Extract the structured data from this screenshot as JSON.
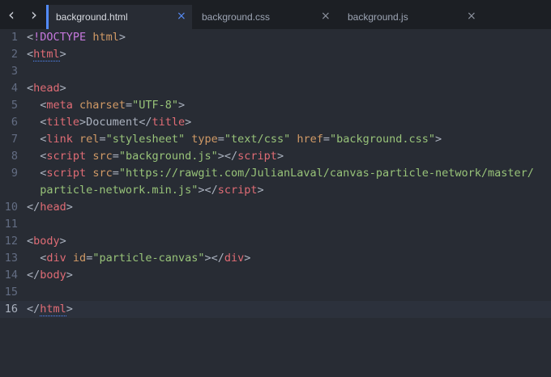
{
  "tabs": [
    {
      "label": "background.html",
      "active": true
    },
    {
      "label": "background.css",
      "active": false
    },
    {
      "label": "background.js",
      "active": false
    }
  ],
  "icons": {
    "back": "chevron-left-icon",
    "forward": "chevron-right-icon",
    "close": "close-icon"
  },
  "colors": {
    "accent": "#528bff",
    "tag": "#e06c75",
    "attribute": "#d19a66",
    "string": "#98c379",
    "doctype": "#c678dd",
    "text": "#abb2bf"
  },
  "editor": {
    "current_line": 16,
    "lines": [
      {
        "num": "1",
        "tokens": [
          {
            "t": "punct",
            "v": "<"
          },
          {
            "t": "doctype",
            "v": "!DOCTYPE"
          },
          {
            "t": "punct",
            "v": " "
          },
          {
            "t": "attr",
            "v": "html"
          },
          {
            "t": "punct",
            "v": ">"
          }
        ]
      },
      {
        "num": "2",
        "tokens": [
          {
            "t": "punct",
            "v": "<"
          },
          {
            "t": "tag",
            "v": "html"
          },
          {
            "t": "punct",
            "v": ">"
          }
        ]
      },
      {
        "num": "3",
        "tokens": []
      },
      {
        "num": "4",
        "tokens": [
          {
            "t": "punct",
            "v": "<"
          },
          {
            "t": "tag",
            "v": "head"
          },
          {
            "t": "punct",
            "v": ">"
          }
        ]
      },
      {
        "num": "5",
        "tokens": [
          {
            "t": "punct",
            "v": "  <"
          },
          {
            "t": "tag",
            "v": "meta"
          },
          {
            "t": "punct",
            "v": " "
          },
          {
            "t": "attr",
            "v": "charset"
          },
          {
            "t": "punct",
            "v": "="
          },
          {
            "t": "str",
            "v": "\"UTF-8\""
          },
          {
            "t": "punct",
            "v": ">"
          }
        ]
      },
      {
        "num": "6",
        "tokens": [
          {
            "t": "punct",
            "v": "  <"
          },
          {
            "t": "tag",
            "v": "title"
          },
          {
            "t": "punct",
            "v": ">"
          },
          {
            "t": "txt",
            "v": "Document"
          },
          {
            "t": "punct",
            "v": "</"
          },
          {
            "t": "tag",
            "v": "title"
          },
          {
            "t": "punct",
            "v": ">"
          }
        ]
      },
      {
        "num": "7",
        "tokens": [
          {
            "t": "punct",
            "v": "  <"
          },
          {
            "t": "tag",
            "v": "link"
          },
          {
            "t": "punct",
            "v": " "
          },
          {
            "t": "attr",
            "v": "rel"
          },
          {
            "t": "punct",
            "v": "="
          },
          {
            "t": "str",
            "v": "\"stylesheet\""
          },
          {
            "t": "punct",
            "v": " "
          },
          {
            "t": "attr",
            "v": "type"
          },
          {
            "t": "punct",
            "v": "="
          },
          {
            "t": "str",
            "v": "\"text/css\""
          },
          {
            "t": "punct",
            "v": " "
          },
          {
            "t": "attr",
            "v": "href"
          },
          {
            "t": "punct",
            "v": "="
          },
          {
            "t": "str",
            "v": "\"background.css\""
          },
          {
            "t": "punct",
            "v": ">"
          }
        ]
      },
      {
        "num": "8",
        "tokens": [
          {
            "t": "punct",
            "v": "  <"
          },
          {
            "t": "tag",
            "v": "script"
          },
          {
            "t": "punct",
            "v": " "
          },
          {
            "t": "attr",
            "v": "src"
          },
          {
            "t": "punct",
            "v": "="
          },
          {
            "t": "str",
            "v": "\"background.js\""
          },
          {
            "t": "punct",
            "v": "></"
          },
          {
            "t": "tag",
            "v": "script"
          },
          {
            "t": "punct",
            "v": ">"
          }
        ]
      },
      {
        "num": "9",
        "tokens": [
          {
            "t": "punct",
            "v": "  <"
          },
          {
            "t": "tag",
            "v": "script"
          },
          {
            "t": "punct",
            "v": " "
          },
          {
            "t": "attr",
            "v": "src"
          },
          {
            "t": "punct",
            "v": "="
          },
          {
            "t": "str",
            "v": "\"https://rawgit.com/JulianLaval/canvas-particle-network/master/"
          }
        ]
      },
      {
        "num": "",
        "tokens": [
          {
            "t": "str",
            "v": "  particle-network.min.js\""
          },
          {
            "t": "punct",
            "v": "></"
          },
          {
            "t": "tag",
            "v": "script"
          },
          {
            "t": "punct",
            "v": ">"
          }
        ]
      },
      {
        "num": "10",
        "tokens": [
          {
            "t": "punct",
            "v": "</"
          },
          {
            "t": "tag",
            "v": "head"
          },
          {
            "t": "punct",
            "v": ">"
          }
        ]
      },
      {
        "num": "11",
        "tokens": []
      },
      {
        "num": "12",
        "tokens": [
          {
            "t": "punct",
            "v": "<"
          },
          {
            "t": "tag",
            "v": "body"
          },
          {
            "t": "punct",
            "v": ">"
          }
        ]
      },
      {
        "num": "13",
        "tokens": [
          {
            "t": "punct",
            "v": "  <"
          },
          {
            "t": "tag",
            "v": "div"
          },
          {
            "t": "punct",
            "v": " "
          },
          {
            "t": "attr",
            "v": "id"
          },
          {
            "t": "punct",
            "v": "="
          },
          {
            "t": "str",
            "v": "\"particle-canvas\""
          },
          {
            "t": "punct",
            "v": "></"
          },
          {
            "t": "tag",
            "v": "div"
          },
          {
            "t": "punct",
            "v": ">"
          }
        ]
      },
      {
        "num": "14",
        "tokens": [
          {
            "t": "punct",
            "v": "</"
          },
          {
            "t": "tag",
            "v": "body"
          },
          {
            "t": "punct",
            "v": ">"
          }
        ]
      },
      {
        "num": "15",
        "tokens": []
      },
      {
        "num": "16",
        "tokens": [
          {
            "t": "punct",
            "v": "</"
          },
          {
            "t": "tag",
            "v": "html"
          },
          {
            "t": "punct",
            "v": ">"
          }
        ]
      }
    ]
  }
}
